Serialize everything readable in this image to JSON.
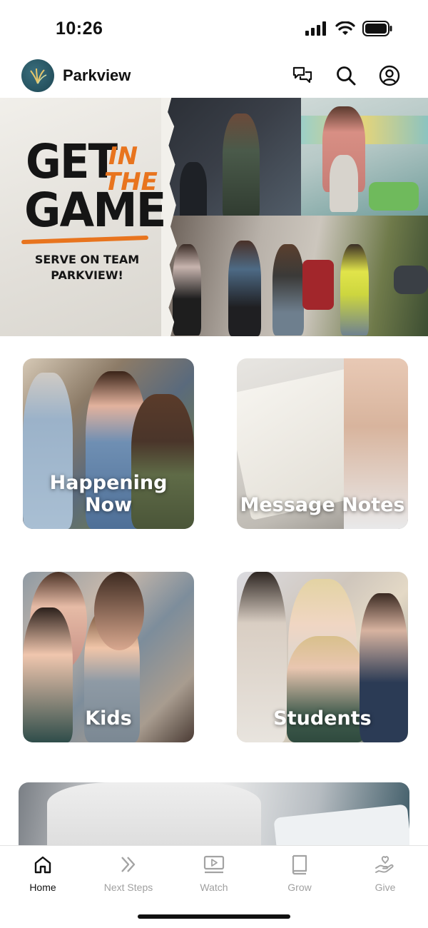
{
  "status_bar": {
    "time": "10:26",
    "icons": [
      "cellular-signal-icon",
      "wifi-icon",
      "battery-icon"
    ]
  },
  "header": {
    "title": "Parkview",
    "logo_icon": "parkview-logo-icon",
    "actions": [
      "chat-icon",
      "search-icon",
      "profile-icon"
    ]
  },
  "hero": {
    "line1": "GET",
    "line2": "GAME",
    "accent1": "IN",
    "accent2": "THE",
    "subtitle": "SERVE ON TEAM PARKVIEW!",
    "accent_color": "#e8741e"
  },
  "tiles": [
    {
      "label": "Happening Now"
    },
    {
      "label": "Message Notes"
    },
    {
      "label": "Kids"
    },
    {
      "label": "Students"
    }
  ],
  "tabs": [
    {
      "label": "Home",
      "icon": "home-icon",
      "active": true
    },
    {
      "label": "Next Steps",
      "icon": "double-chevron-right-icon",
      "active": false
    },
    {
      "label": "Watch",
      "icon": "play-video-icon",
      "active": false
    },
    {
      "label": "Grow",
      "icon": "book-icon",
      "active": false
    },
    {
      "label": "Give",
      "icon": "hand-heart-icon",
      "active": false
    }
  ]
}
